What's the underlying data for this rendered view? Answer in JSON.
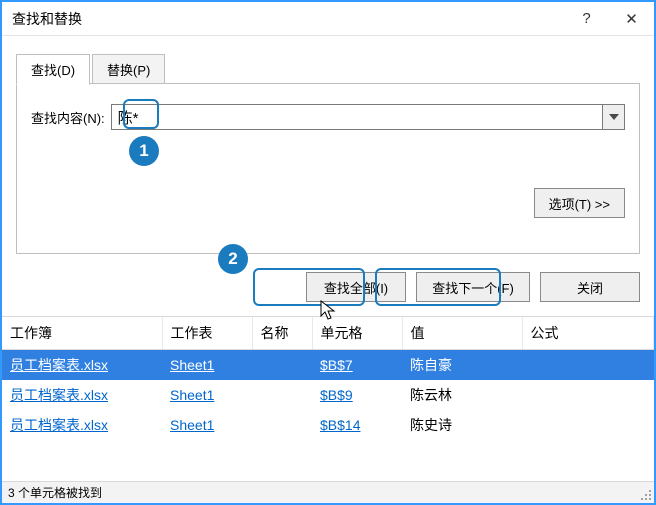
{
  "window": {
    "title": "查找和替换",
    "help": "?",
    "close": "✕"
  },
  "tabs": {
    "find": "查找(D)",
    "replace": "替换(P)"
  },
  "find": {
    "label": "查找内容(N):",
    "value": "陈*",
    "options_btn": "选项(T) >>"
  },
  "buttons": {
    "find_all": "查找全部(I)",
    "find_next": "查找下一个(F)",
    "close": "关闭"
  },
  "callouts": {
    "one": "1",
    "two": "2"
  },
  "table": {
    "headers": {
      "workbook": "工作簿",
      "sheet": "工作表",
      "name": "名称",
      "cell": "单元格",
      "value": "值",
      "formula": "公式"
    },
    "rows": [
      {
        "workbook": "员工档案表.xlsx",
        "sheet": "Sheet1",
        "name": "",
        "cell": "$B$7",
        "value": "陈自豪",
        "formula": "",
        "selected": true
      },
      {
        "workbook": "员工档案表.xlsx",
        "sheet": "Sheet1",
        "name": "",
        "cell": "$B$9",
        "value": "陈云林",
        "formula": "",
        "selected": false
      },
      {
        "workbook": "员工档案表.xlsx",
        "sheet": "Sheet1",
        "name": "",
        "cell": "$B$14",
        "value": "陈史诗",
        "formula": "",
        "selected": false
      }
    ]
  },
  "status": "3 个单元格被找到"
}
